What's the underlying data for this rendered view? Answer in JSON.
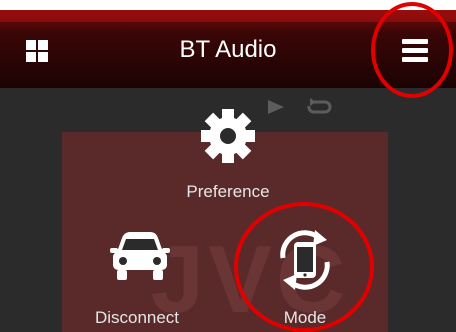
{
  "header": {
    "title": "BT Audio",
    "left_icon": "apps-grid-icon",
    "right_icon": "hamburger-menu-icon"
  },
  "playback": {
    "play_icon": "play-icon",
    "repeat_icon": "repeat-icon"
  },
  "tiles": [
    {
      "label": "Preference",
      "icon": "gear-icon"
    },
    {
      "label": "Disconnect",
      "icon": "car-icon"
    },
    {
      "label": "Mode",
      "icon": "phone-rotate-icon"
    }
  ],
  "background": {
    "watermark": "JVC"
  },
  "annotations": {
    "highlight_color": "#e00000",
    "highlighted": [
      "hamburger-menu-icon",
      "mode-button"
    ]
  },
  "colors": {
    "header_accent": "#7a0a0a",
    "panel": "#2b2b2b",
    "text": "#ffffff"
  }
}
